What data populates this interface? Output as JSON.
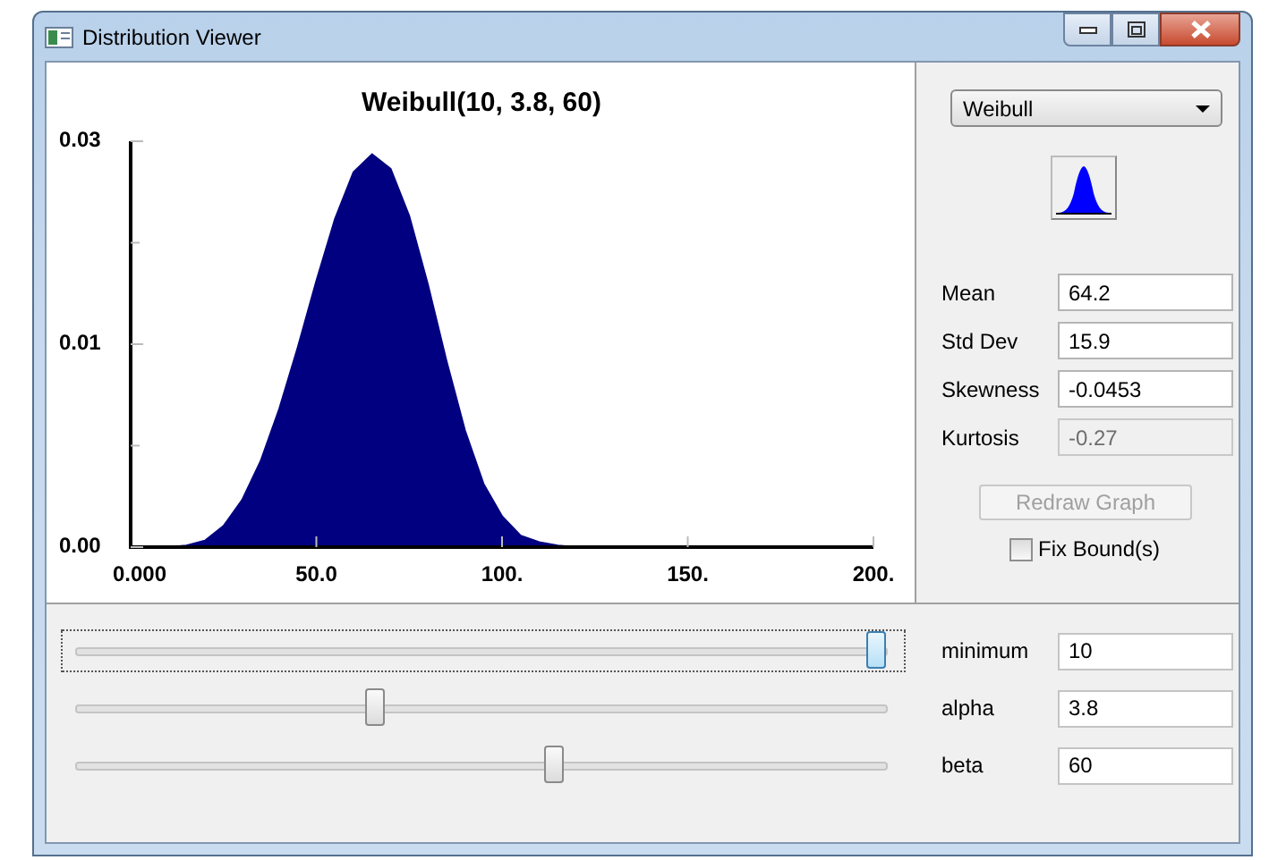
{
  "window": {
    "title": "Distribution Viewer",
    "controls": [
      {
        "kind": "minimize"
      },
      {
        "kind": "maximize"
      },
      {
        "kind": "close"
      }
    ]
  },
  "chart": {
    "chart_data": {
      "type": "area",
      "title": "Weibull(10, 3.8, 60)",
      "x": [
        0,
        5,
        10,
        15,
        20,
        25,
        30,
        35,
        40,
        45,
        50,
        55,
        60,
        65,
        70,
        75,
        80,
        85,
        90,
        95,
        100,
        105,
        110,
        115,
        120,
        125,
        130,
        135,
        140,
        145,
        150,
        155,
        160,
        165,
        170,
        175,
        180,
        185,
        190,
        195,
        200
      ],
      "series": [
        {
          "color": "#000080",
          "values": [
            0,
            0,
            0,
            0.0001,
            0.0004,
            0.0013,
            0.0029,
            0.0053,
            0.0085,
            0.0123,
            0.0164,
            0.0202,
            0.0231,
            0.0242,
            0.0233,
            0.0204,
            0.0162,
            0.0115,
            0.0072,
            0.0039,
            0.0019,
            0.0007,
            0.0003,
            0.0001,
            0,
            0,
            0,
            0,
            0,
            0,
            0,
            0,
            0,
            0,
            0,
            0,
            0,
            0,
            0,
            0,
            0
          ]
        }
      ],
      "xlim": [
        0,
        200
      ],
      "ylim": [
        0,
        0.025
      ],
      "xticks": [
        {
          "value": 0,
          "label": "0.000"
        },
        {
          "value": 50,
          "label": "50.0"
        },
        {
          "value": 100,
          "label": "100."
        },
        {
          "value": 150,
          "label": "150."
        },
        {
          "value": 200,
          "label": "200."
        }
      ],
      "yticks": [
        {
          "value": 0,
          "label": "0.00"
        },
        {
          "value": 0.0125,
          "label": "0.01"
        },
        {
          "value": 0.025,
          "label": "0.03"
        }
      ]
    }
  },
  "side": {
    "distribution": "Weibull",
    "stats": [
      {
        "label": "Mean",
        "value": "64.2",
        "disabled": false
      },
      {
        "label": "Std Dev",
        "value": "15.9",
        "disabled": false
      },
      {
        "label": "Skewness",
        "value": "-0.0453",
        "disabled": false
      },
      {
        "label": "Kurtosis",
        "value": "-0.27",
        "disabled": true
      }
    ],
    "redraw": {
      "label": "Redraw Graph",
      "disabled": true
    },
    "fix_bounds": {
      "label": "Fix Bound(s)",
      "checked": false
    }
  },
  "sliders": [
    {
      "label": "minimum",
      "value": "10",
      "level": 0.99,
      "focused": true
    },
    {
      "label": "alpha",
      "value": "3.8",
      "level": 0.37,
      "focused": false
    },
    {
      "label": "beta",
      "value": "60",
      "level": 0.59,
      "focused": false
    }
  ]
}
